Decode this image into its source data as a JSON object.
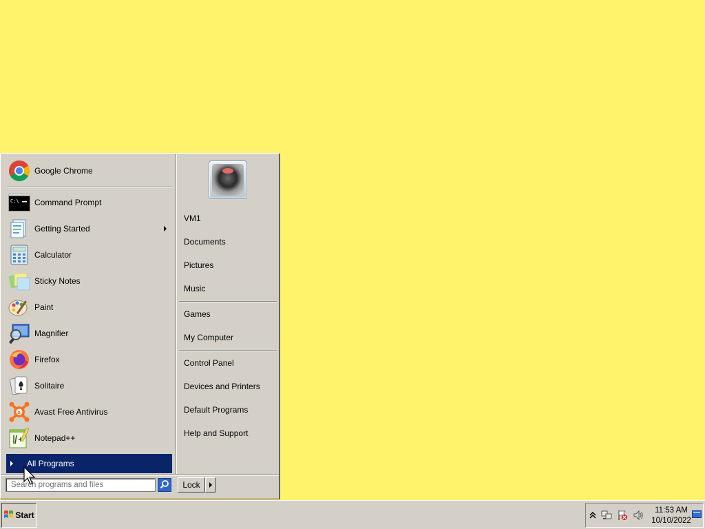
{
  "start_menu": {
    "pinned": [
      {
        "label": "Google Chrome",
        "icon": "chrome-icon"
      }
    ],
    "recent": [
      {
        "label": "Command Prompt",
        "icon": "command-prompt-icon"
      },
      {
        "label": "Getting Started",
        "icon": "getting-started-icon",
        "submenu": true
      },
      {
        "label": "Calculator",
        "icon": "calculator-icon"
      },
      {
        "label": "Sticky Notes",
        "icon": "sticky-notes-icon"
      },
      {
        "label": "Paint",
        "icon": "paint-icon"
      },
      {
        "label": "Magnifier",
        "icon": "magnifier-icon"
      },
      {
        "label": "Firefox",
        "icon": "firefox-icon"
      },
      {
        "label": "Solitaire",
        "icon": "solitaire-icon"
      },
      {
        "label": "Avast Free Antivirus",
        "icon": "avast-icon"
      },
      {
        "label": "Notepad++",
        "icon": "notepad-plus-plus-icon"
      }
    ],
    "all_programs_label": "All Programs",
    "search_placeholder": "Search programs and files",
    "right_items": {
      "group1": [
        "VM1",
        "Documents",
        "Pictures",
        "Music"
      ],
      "group2": [
        "Games",
        "My Computer"
      ],
      "group3": [
        "Control Panel",
        "Devices and Printers",
        "Default Programs",
        "Help and Support"
      ]
    },
    "lock_label": "Lock"
  },
  "taskbar": {
    "start_label": "Start",
    "clock_time": "11:53 AM",
    "clock_date": "10/10/2022"
  },
  "colors": {
    "desktop": "#fff36b",
    "menu_face": "#d4d0c8",
    "highlight": "#0a246a"
  }
}
